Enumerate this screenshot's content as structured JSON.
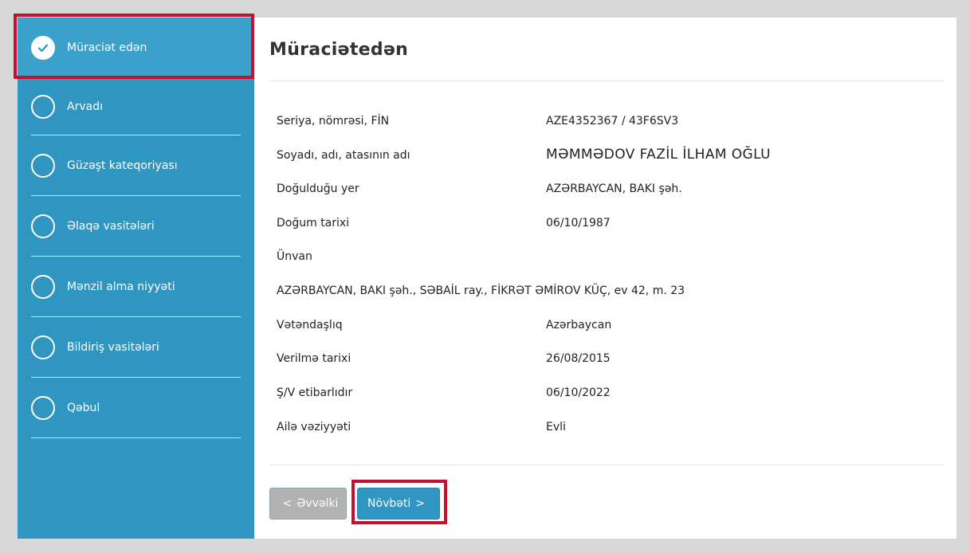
{
  "sidebar": {
    "steps": [
      {
        "label": "Müraciət edən",
        "state": "done"
      },
      {
        "label": "Arvadı",
        "state": "pending"
      },
      {
        "label": "Güzəşt kateqoriyası",
        "state": "pending"
      },
      {
        "label": "Əlaqə vasitələri",
        "state": "pending"
      },
      {
        "label": "Mənzil alma niyyəti",
        "state": "pending"
      },
      {
        "label": "Bildiriş vasitələri",
        "state": "pending"
      },
      {
        "label": "Qəbul",
        "state": "pending"
      }
    ]
  },
  "main": {
    "title": "Müraciətedən",
    "fields": [
      {
        "key": "Seriya, nömrəsi, FİN",
        "value": "AZE4352367 / 43F6SV3"
      },
      {
        "key": "Soyadı, adı, atasının adı",
        "value": "MƏMMƏDOV FAZİL İLHAM OĞLU"
      },
      {
        "key": "Doğulduğu yer",
        "value": "AZƏRBAYCAN, BAKI şəh."
      },
      {
        "key": "Doğum tarixi",
        "value": "06/10/1987"
      },
      {
        "key": "Ünvan",
        "value": ""
      },
      {
        "key": "Vətəndaşlıq",
        "value": "Azərbaycan"
      },
      {
        "key": "Verilmə tarixi",
        "value": "26/08/2015"
      },
      {
        "key": "Ş/V etibarlıdır",
        "value": "06/10/2022"
      },
      {
        "key": "Ailə vəziyyəti",
        "value": "Evli"
      }
    ],
    "address": "AZƏRBAYCAN, BAKI şəh., SƏBAİL ray., FİKRƏT ƏMİROV KÜÇ, ev 42, m. 23"
  },
  "buttons": {
    "prev_label": "Əvvəlki",
    "next_label": "Növbəti",
    "prev_chevron": "<",
    "next_chevron": ">"
  },
  "colors": {
    "sidebar": "#2f96c2",
    "highlight": "#c8102e",
    "button_primary": "#2f96c2",
    "button_disabled": "#b2b2b2"
  }
}
